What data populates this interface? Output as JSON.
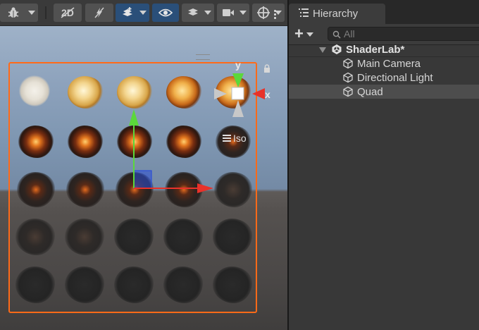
{
  "scene": {
    "toolbar_buttons": [
      {
        "name": "debug-bug-icon"
      },
      {
        "name": "hide-effects-icon"
      },
      {
        "name": "lighting-off-icon"
      },
      {
        "name": "layers-visibility-icon"
      },
      {
        "name": "eye-icon"
      },
      {
        "name": "draw-mode-icon"
      },
      {
        "name": "camera-icon"
      },
      {
        "name": "gizmos-icon"
      }
    ],
    "gizmo": {
      "y_label": "y",
      "x_label": "x",
      "projection_label": "Iso"
    },
    "colors": {
      "selection": "#ff6a18",
      "axis_x": "#e8322a",
      "axis_y": "#5bd83a",
      "axis_z": "#2c4fd6",
      "sky": "#8da2bc",
      "ground": "#4a4746"
    }
  },
  "hierarchy": {
    "tab_title": "Hierarchy",
    "search": {
      "placeholder": "All",
      "value": ""
    },
    "items": [
      {
        "label": "ShaderLab*",
        "level": 0,
        "expanded": true
      },
      {
        "label": "Main Camera",
        "level": 1
      },
      {
        "label": "Directional Light",
        "level": 1
      },
      {
        "label": "Quad",
        "level": 1,
        "selected": true
      }
    ]
  }
}
